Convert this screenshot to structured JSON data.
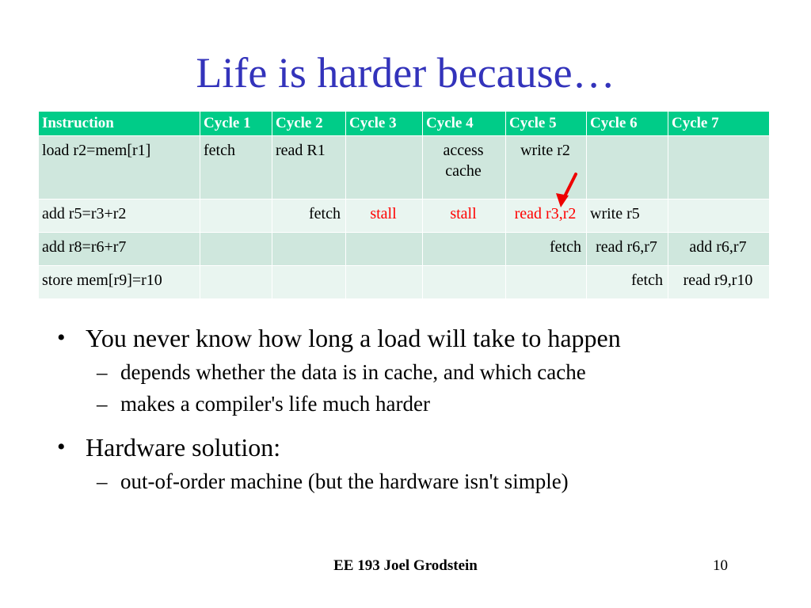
{
  "slide": {
    "title": "Life is harder because…",
    "title_color": "#3333bb",
    "background_color": "#ffffff"
  },
  "table": {
    "header_bg": "#00cc88",
    "header_text_color": "#ffffff",
    "row_dark_bg": "#cfe7dd",
    "row_light_bg": "#e9f5f0",
    "stall_color": "#ff0000",
    "columns": [
      "Instruction",
      "Cycle 1",
      "Cycle 2",
      "Cycle 3",
      "Cycle 4",
      "Cycle 5",
      "Cycle 6",
      "Cycle 7"
    ],
    "rows": [
      {
        "instruction": "load r2=mem[r1]",
        "cycle1": "fetch",
        "cycle2": "read R1",
        "cycle3": "",
        "cycle4": "access cache",
        "cycle5": "write r2",
        "cycle6": "",
        "cycle7": ""
      },
      {
        "instruction": "add r5=r3+r2",
        "cycle1": "",
        "cycle2": "fetch",
        "cycle3": "stall",
        "cycle4": "stall",
        "cycle5": "read r3,r2",
        "cycle6": "write r5",
        "cycle7": ""
      },
      {
        "instruction": "add r8=r6+r7",
        "cycle1": "",
        "cycle2": "",
        "cycle3": "",
        "cycle4": "",
        "cycle5": "fetch",
        "cycle6": "read r6,r7",
        "cycle7": "add r6,r7"
      },
      {
        "instruction": "store mem[r9]=r10",
        "cycle1": "",
        "cycle2": "",
        "cycle3": "",
        "cycle4": "",
        "cycle5": "",
        "cycle6": "fetch",
        "cycle7": "read r9,r10"
      }
    ]
  },
  "annotation": {
    "arrow_color": "#ee0000",
    "arrow_name": "dependency-arrow"
  },
  "body": {
    "bullets": [
      {
        "level": 1,
        "marker": "•",
        "text": "You never know how long a load will take to happen"
      },
      {
        "level": 2,
        "marker": "–",
        "text": "depends whether the data is in cache, and which cache"
      },
      {
        "level": 2,
        "marker": "–",
        "text": "makes a compiler's life much harder"
      },
      {
        "level": 1,
        "marker": "•",
        "text": "Hardware solution:"
      },
      {
        "level": 2,
        "marker": "–",
        "text": "out-of-order machine (but the hardware isn't simple)"
      }
    ]
  },
  "footer": {
    "author": "EE 193 Joel Grodstein",
    "page_number": "10"
  }
}
